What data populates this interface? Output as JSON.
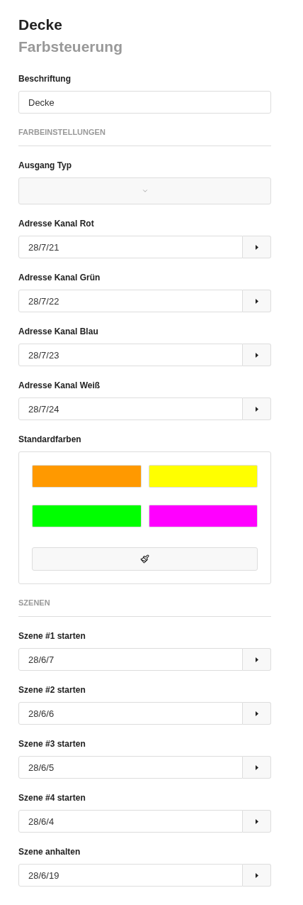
{
  "header": {
    "title": "Decke",
    "subtitle": "Farbsteuerung"
  },
  "items": [
    {
      "kind": "text",
      "label": "Beschriftung",
      "value": "Decke"
    }
  ],
  "sections": [
    {
      "heading": "FARBEINSTELLUNGEN",
      "items": [
        {
          "kind": "select",
          "label": "Ausgang Typ"
        },
        {
          "kind": "address",
          "label": "Adresse Kanal Rot",
          "value": "28/7/21"
        },
        {
          "kind": "address",
          "label": "Adresse Kanal Grün",
          "value": "28/7/22"
        },
        {
          "kind": "address",
          "label": "Adresse Kanal Blau",
          "value": "28/7/23"
        },
        {
          "kind": "address",
          "label": "Adresse Kanal Weiß",
          "value": "28/7/24"
        },
        {
          "kind": "swatches",
          "label": "Standardfarben",
          "swatches": [
            {
              "color": "#ff9900"
            },
            {
              "color": "#ffff00"
            },
            {
              "color": "#00ff00"
            },
            {
              "color": "#ff00ff"
            }
          ]
        }
      ]
    },
    {
      "heading": "SZENEN",
      "items": [
        {
          "kind": "address",
          "label": "Szene #1 starten",
          "value": "28/6/7"
        },
        {
          "kind": "address",
          "label": "Szene #2 starten",
          "value": "28/6/6"
        },
        {
          "kind": "address",
          "label": "Szene #3 starten",
          "value": "28/6/5"
        },
        {
          "kind": "address",
          "label": "Szene #4 starten",
          "value": "28/6/4"
        },
        {
          "kind": "address",
          "label": "Szene anhalten",
          "value": "28/6/19"
        }
      ]
    }
  ]
}
